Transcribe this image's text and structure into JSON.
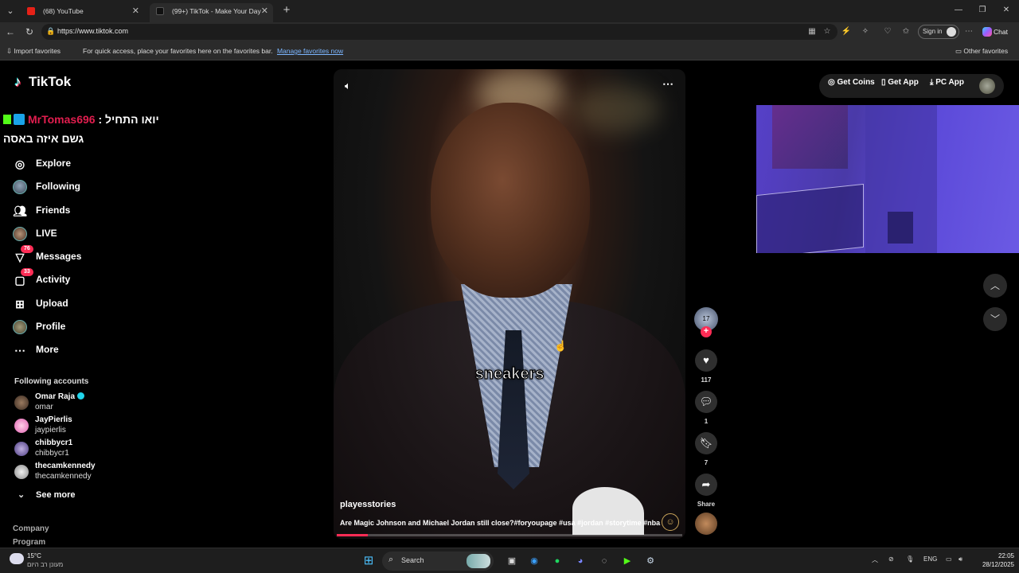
{
  "browser": {
    "tabs": [
      {
        "title": "(68) YouTube",
        "active": false
      },
      {
        "title": "(99+) TikTok - Make Your Day",
        "active": true
      }
    ],
    "url": "https://www.tiktok.com",
    "sign_in": "Sign in",
    "chat": "Chat",
    "favorites": {
      "import": "Import favorites",
      "hint": "For quick access, place your favorites here on the favorites bar.",
      "manage": "Manage favorites now",
      "other": "Other favorites"
    }
  },
  "tiktok": {
    "logo": "TikTok",
    "overlay_chat": {
      "username": "MrTomas696",
      "separator": ":",
      "line1": "יואו התחיל",
      "line2": "גשם איזה באסה"
    },
    "nav": [
      {
        "label": "Explore",
        "icon": "compass-icon"
      },
      {
        "label": "Following",
        "icon": "following-avatar-icon"
      },
      {
        "label": "Friends",
        "icon": "friends-icon"
      },
      {
        "label": "LIVE",
        "icon": "live-avatar-icon"
      },
      {
        "label": "Messages",
        "icon": "messages-icon",
        "badge": "76"
      },
      {
        "label": "Activity",
        "icon": "activity-icon",
        "badge": "33"
      },
      {
        "label": "Upload",
        "icon": "upload-icon"
      },
      {
        "label": "Profile",
        "icon": "profile-avatar-icon"
      },
      {
        "label": "More",
        "icon": "more-dots-icon"
      }
    ],
    "following_title": "Following accounts",
    "following": [
      {
        "name": "Omar Raja",
        "handle": "omar",
        "verified": true
      },
      {
        "name": "JayPierlis",
        "handle": "jaypierlis"
      },
      {
        "name": "chibbycr1",
        "handle": "chibbycr1"
      },
      {
        "name": "thecamkennedy",
        "handle": "thecamkennedy"
      }
    ],
    "see_more": "See more",
    "footer": [
      "Company",
      "Program"
    ],
    "top_actions": {
      "coins": "Get Coins",
      "app": "Get App",
      "pc": "PC App"
    },
    "video": {
      "caption": "sneakers",
      "author": "playesstories",
      "description": "Are Magic Johnson and Michael Jordan still close?#foryoupage #usa #jordan #storytime #nba",
      "progress": 0.09
    },
    "actions": {
      "avatar_text": "17",
      "likes": "117",
      "comments": "1",
      "saves": "7",
      "share": "Share"
    }
  },
  "taskbar": {
    "temperature": "15°C",
    "condition": "מעונן רב היום",
    "search": "Search",
    "language": "ENG",
    "time": "22:05",
    "date": "28/12/2025"
  },
  "colors": {
    "accent": "#fe2c55",
    "verified": "#20d5ec",
    "chat_user": "#e21e4f"
  }
}
